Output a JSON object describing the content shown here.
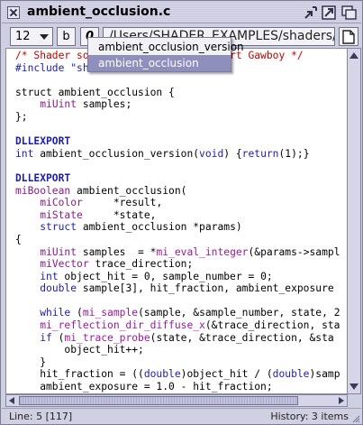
{
  "window": {
    "title": "ambient_occlusion.c"
  },
  "toolbar": {
    "font_size": "12",
    "bold_label": "b",
    "italic_label": "0",
    "path": "/Users/SHADER_EXAMPLES/shaders/an"
  },
  "dropdown": {
    "items": [
      {
        "label": "ambient_occlusion_version",
        "selected": false
      },
      {
        "label": "ambient_occlusion",
        "selected": true
      }
    ]
  },
  "code": {
    "lines": [
      [
        [
          "cm",
          "/* Shader sou"
        ],
        [
          "cm",
          "                    "
        ],
        [
          "cm",
          "Bart Gawboy */"
        ]
      ],
      [
        [
          "pp",
          "#include \"sh"
        ]
      ],
      [],
      [
        [
          "",
          "struct ambient_occlusion {"
        ]
      ],
      [
        [
          "",
          "    "
        ],
        [
          "ty",
          "miUint"
        ],
        [
          "",
          " samples;"
        ]
      ],
      [
        [
          "",
          "};"
        ]
      ],
      [],
      [
        [
          "ex",
          "DLLEXPORT"
        ]
      ],
      [
        [
          "kw",
          "int"
        ],
        [
          "",
          " ambient_occlusion_version("
        ],
        [
          "kw",
          "void"
        ],
        [
          "",
          ") {"
        ],
        [
          "kw",
          "return"
        ],
        [
          "",
          "(1);}"
        ]
      ],
      [],
      [
        [
          "ex",
          "DLLEXPORT"
        ]
      ],
      [
        [
          "ty",
          "miBoolean"
        ],
        [
          "",
          " ambient_occlusion("
        ]
      ],
      [
        [
          "",
          "    "
        ],
        [
          "ty",
          "miColor"
        ],
        [
          "",
          "     *result,"
        ]
      ],
      [
        [
          "",
          "    "
        ],
        [
          "ty",
          "miState"
        ],
        [
          "",
          "     *state,"
        ]
      ],
      [
        [
          "",
          "    "
        ],
        [
          "kw",
          "struct"
        ],
        [
          "",
          " ambient_occlusion *params)"
        ]
      ],
      [
        [
          "",
          "{"
        ]
      ],
      [
        [
          "",
          "    "
        ],
        [
          "ty",
          "miUint"
        ],
        [
          "",
          " samples  = *"
        ],
        [
          "fn",
          "mi_eval_integer"
        ],
        [
          "",
          "(&params->sampl"
        ]
      ],
      [
        [
          "",
          "    "
        ],
        [
          "ty",
          "miVector"
        ],
        [
          "",
          " trace_direction;"
        ]
      ],
      [
        [
          "",
          "    "
        ],
        [
          "kw",
          "int"
        ],
        [
          "",
          " object_hit = 0, sample_number = 0;"
        ]
      ],
      [
        [
          "",
          "    "
        ],
        [
          "kw",
          "double"
        ],
        [
          "",
          " sample[3], hit_fraction, ambient_exposure"
        ]
      ],
      [],
      [
        [
          "",
          "    "
        ],
        [
          "kw",
          "while"
        ],
        [
          "",
          " ("
        ],
        [
          "fn",
          "mi_sample"
        ],
        [
          "",
          "(sample, &sample_number, state, 2"
        ]
      ],
      [
        [
          "",
          "    "
        ],
        [
          "fn",
          "mi_reflection_dir_diffuse_x"
        ],
        [
          "",
          "(&trace_direction, sta"
        ]
      ],
      [
        [
          "",
          "    "
        ],
        [
          "kw",
          "if"
        ],
        [
          "",
          " ("
        ],
        [
          "fn",
          "mi_trace_probe"
        ],
        [
          "",
          "(state, &trace_direction, &sta"
        ]
      ],
      [
        [
          "",
          "        object_hit++;"
        ]
      ],
      [
        [
          "",
          "    }"
        ]
      ],
      [
        [
          "",
          "    hit_fraction = (("
        ],
        [
          "kw",
          "double"
        ],
        [
          "",
          ")object_hit / ("
        ],
        [
          "kw",
          "double"
        ],
        [
          "",
          ")samp"
        ]
      ],
      [
        [
          "",
          "    ambient_exposure = 1.0 - hit_fraction;"
        ]
      ],
      [
        [
          "",
          "    result->r = result->g = result->b = ambient_expos"
        ]
      ],
      [
        [
          "",
          "    result->a = 1.0;"
        ]
      ],
      [
        [
          "",
          "    "
        ],
        [
          "kw",
          "return"
        ],
        [
          "",
          " miTRUE;"
        ]
      ],
      [
        [
          "",
          "}"
        ]
      ]
    ]
  },
  "status": {
    "position": "Line: 5 [117]",
    "history": "History: 3 items"
  },
  "icons": {
    "close": "close-icon",
    "collapse": "collapse-icon",
    "zoom": "zoom-icon",
    "stack": "window-stack-icon",
    "file": "document-icon",
    "dropdown_arrow": "chevron-down-icon"
  },
  "colors": {
    "chrome": "#cfcfe2",
    "selection": "#8f8fbd",
    "comment": "#c00000",
    "keyword": "#1c1cae",
    "function": "#9a1a9a"
  }
}
